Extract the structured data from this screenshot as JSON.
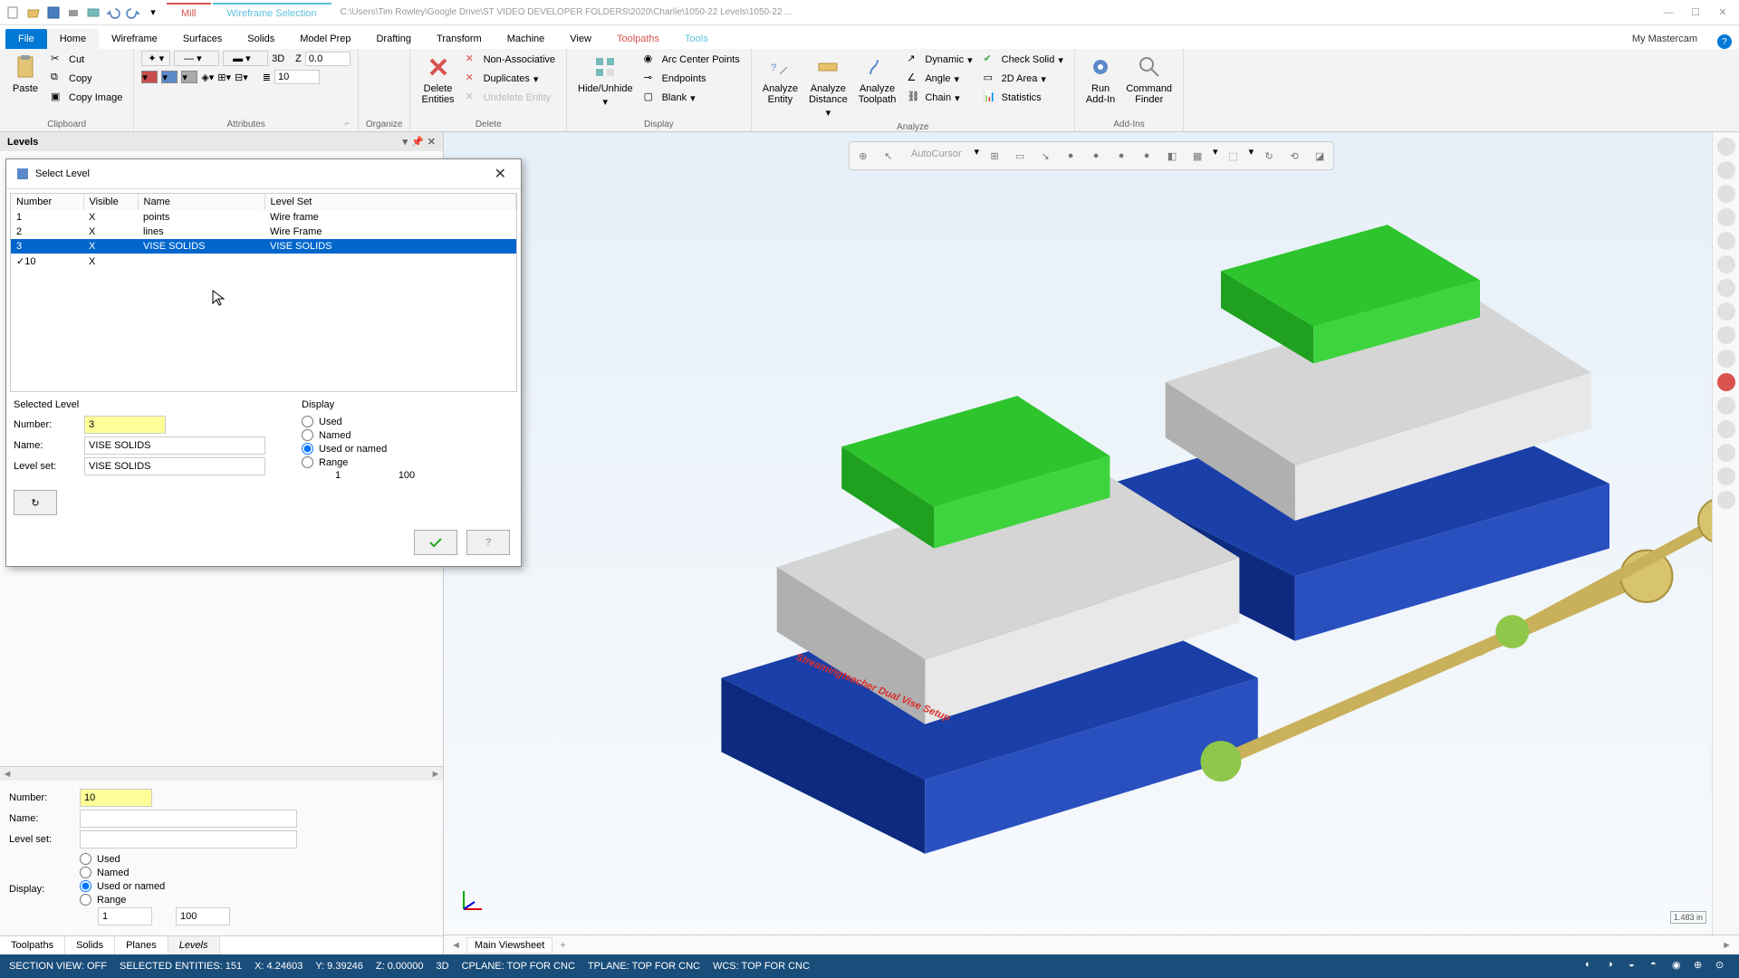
{
  "titlebar": {
    "context_tabs": {
      "mill": "Mill",
      "wireframe_sel": "Wireframe Selection"
    },
    "filepath": "C:\\Users\\Tim Rowley\\Google Drive\\ST VIDEO DEVELOPER FOLDERS\\2020\\Charlie\\1050-22 Levels\\1050-22 ..."
  },
  "ribbon_tabs": {
    "file": "File",
    "home": "Home",
    "wireframe": "Wireframe",
    "surfaces": "Surfaces",
    "solids": "Solids",
    "modelprep": "Model Prep",
    "drafting": "Drafting",
    "transform": "Transform",
    "machine": "Machine",
    "view": "View",
    "toolpaths": "Toolpaths",
    "tools": "Tools",
    "my": "My Mastercam"
  },
  "ribbon": {
    "clipboard": {
      "label": "Clipboard",
      "paste": "Paste",
      "cut": "Cut",
      "copy": "Copy",
      "copyimg": "Copy Image"
    },
    "attributes": {
      "label": "Attributes",
      "dim": "3D",
      "zlbl": "Z",
      "zval": "0.0",
      "layer": "10"
    },
    "organize": {
      "label": "Organize",
      "del": "Delete\nEntities",
      "nonassoc": "Non-Associative",
      "dup": "Duplicates",
      "undel": "Undelete Entity"
    },
    "delete": {
      "label": "Delete"
    },
    "display": {
      "label": "Display",
      "hide": "Hide/Unhide",
      "arc": "Arc Center Points",
      "end": "Endpoints",
      "blank": "Blank"
    },
    "analyze": {
      "label": "Analyze",
      "entity": "Analyze\nEntity",
      "dist": "Analyze\nDistance",
      "tp": "Analyze\nToolpath",
      "dyn": "Dynamic",
      "angle": "Angle",
      "chain": "Chain",
      "check": "Check Solid",
      "area": "2D Area",
      "stats": "Statistics"
    },
    "addins": {
      "label": "Add-Ins",
      "run": "Run\nAdd-In",
      "cmd": "Command\nFinder"
    }
  },
  "panel": {
    "title": "Levels",
    "lower_number_lbl": "Number:",
    "lower_number": "10",
    "lower_name_lbl": "Name:",
    "lower_name": "",
    "lower_set_lbl": "Level set:",
    "lower_set": "",
    "display_lbl": "Display:",
    "used": "Used",
    "named": "Named",
    "usednamed": "Used or named",
    "range": "Range",
    "range_from": "1",
    "range_to": "100"
  },
  "bottom_tabs": {
    "toolpaths": "Toolpaths",
    "solids": "Solids",
    "planes": "Planes",
    "levels": "Levels"
  },
  "dialog": {
    "title": "Select Level",
    "cols": {
      "num": "Number",
      "vis": "Visible",
      "name": "Name",
      "set": "Level Set"
    },
    "rows": [
      {
        "num": "1",
        "vis": "X",
        "name": "points",
        "set": "Wire frame"
      },
      {
        "num": "2",
        "vis": "X",
        "name": "lines",
        "set": "Wire Frame"
      },
      {
        "num": "3",
        "vis": "X",
        "name": "VISE SOLIDS",
        "set": "VISE SOLIDS",
        "selected": true
      },
      {
        "num": "✓10",
        "vis": "X",
        "name": "",
        "set": ""
      }
    ],
    "sel_label": "Selected Level",
    "num_lbl": "Number:",
    "num": "3",
    "name_lbl": "Name:",
    "name": "VISE SOLIDS",
    "set_lbl": "Level set:",
    "set": "VISE SOLIDS",
    "disp_label": "Display",
    "used": "Used",
    "named": "Named",
    "usednamed": "Used or named",
    "range": "Range",
    "range_from": "1",
    "range_to": "100"
  },
  "viewport": {
    "toolbar_label": "AutoCursor",
    "watermark1": "Streamingteacher Dual Vise Setup",
    "viewsheet": "Main Viewsheet",
    "scale": "1.483 in"
  },
  "statusbar": {
    "section": "SECTION VIEW: OFF",
    "sel": "SELECTED ENTITIES: 151",
    "x": "X: 4.24603",
    "y": "Y: 9.39246",
    "z": "Z: 0.00000",
    "mode": "3D",
    "cplane": "CPLANE: TOP FOR CNC",
    "tplane": "TPLANE: TOP FOR CNC",
    "wcs": "WCS: TOP FOR CNC"
  }
}
